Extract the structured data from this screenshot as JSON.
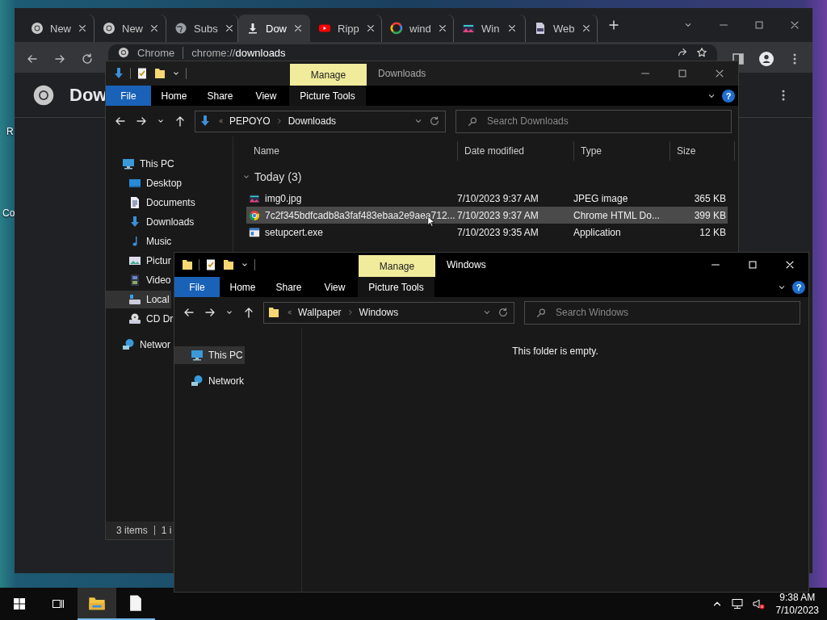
{
  "desktop": {
    "icon_labels": [
      "R",
      "Co"
    ]
  },
  "browser": {
    "tabs": [
      {
        "label": "New",
        "kind": "wheel",
        "selected": false
      },
      {
        "label": "New",
        "kind": "wheel",
        "selected": false
      },
      {
        "label": "Subs",
        "kind": "globe",
        "selected": false
      },
      {
        "label": "Dow",
        "kind": "download",
        "selected": true
      },
      {
        "label": "Ripp",
        "kind": "play",
        "selected": false
      },
      {
        "label": "wind",
        "kind": "ring",
        "selected": false
      },
      {
        "label": "Win",
        "kind": "image",
        "selected": false
      },
      {
        "label": "Web",
        "kind": "doc",
        "selected": false
      }
    ],
    "address": {
      "site": "Chrome",
      "url": "chrome://**downloads**"
    },
    "page_title": "Dow"
  },
  "explorers": [
    {
      "title": "Downloads",
      "active": false,
      "kind": "downloads",
      "context_tab": "Manage",
      "ribbon_tabs": [
        {
          "label": "File",
          "kind": "file"
        },
        {
          "label": "Home",
          "kind": "tab"
        },
        {
          "label": "Share",
          "kind": "tab"
        },
        {
          "label": "View",
          "kind": "tab"
        },
        {
          "label": "Picture Tools",
          "kind": "context"
        }
      ],
      "help_button": "?",
      "path": [
        "PEPOYO",
        "Downloads"
      ],
      "search": {
        "placeholder": "Search Downloads"
      },
      "nav": [
        {
          "label": "This PC",
          "kind": "pc",
          "selected": false,
          "children": [
            {
              "label": "Desktop",
              "kind": "desktop",
              "selected": false
            },
            {
              "label": "Documents",
              "kind": "documents",
              "selected": false
            },
            {
              "label": "Downloads",
              "kind": "downloads",
              "selected": false
            },
            {
              "label": "Music",
              "kind": "music",
              "selected": false
            },
            {
              "label": "Pictur",
              "kind": "pictures",
              "selected": false
            },
            {
              "label": "Video",
              "kind": "videos",
              "selected": false
            },
            {
              "label": "Local",
              "kind": "drive",
              "selected": true
            },
            {
              "label": "CD Dr",
              "kind": "cd",
              "selected": false
            }
          ]
        },
        {
          "label": "Networ",
          "kind": "network",
          "selected": false
        }
      ],
      "columns": [
        "Name",
        "Date modified",
        "Type",
        "Size"
      ],
      "groups": [
        {
          "label": "Today (3)",
          "rows": [
            {
              "name": "img0.jpg",
              "kind": "image",
              "date": "7/10/2023 9:37 AM",
              "type": "JPEG image",
              "size": "365 KB",
              "selected": false
            },
            {
              "name": "7c2f345bdfcadb8a3faf483ebaa2e9aea712...",
              "kind": "chrome",
              "date": "7/10/2023 9:37 AM",
              "type": "Chrome HTML Do...",
              "size": "399 KB",
              "selected": true
            },
            {
              "name": "setupcert.exe",
              "kind": "app",
              "date": "7/10/2023 9:35 AM",
              "type": "Application",
              "size": "12 KB",
              "selected": false
            }
          ]
        }
      ],
      "status": [
        "3 items",
        "1 i"
      ]
    },
    {
      "title": "Windows",
      "active": true,
      "kind": "folder",
      "context_tab": "Manage",
      "ribbon_tabs": [
        {
          "label": "File",
          "kind": "file"
        },
        {
          "label": "Home",
          "kind": "tab"
        },
        {
          "label": "Share",
          "kind": "tab"
        },
        {
          "label": "View",
          "kind": "tab"
        },
        {
          "label": "Picture Tools",
          "kind": "context"
        }
      ],
      "help_button": "?",
      "path": [
        "Wallpaper",
        "Windows"
      ],
      "search": {
        "placeholder": "Search Windows"
      },
      "nav": [
        {
          "label": "This PC",
          "kind": "pc",
          "selected": true
        },
        {
          "label": "Network",
          "kind": "network",
          "selected": false
        }
      ],
      "empty_message": "This folder is empty."
    }
  ],
  "taskbar": {
    "apps": [
      {
        "kind": "explorer",
        "selected": true
      },
      {
        "kind": "file",
        "selected": false
      }
    ],
    "time": "9:38 AM",
    "date": "7/10/2023"
  }
}
